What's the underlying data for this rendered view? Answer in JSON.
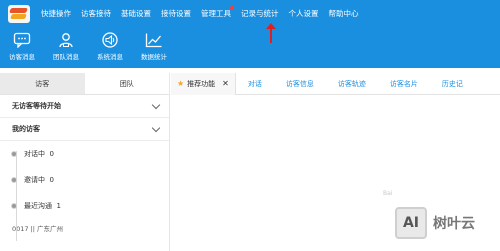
{
  "header": {
    "menu": [
      {
        "label": "快捷操作"
      },
      {
        "label": "访客接待"
      },
      {
        "label": "基础设置"
      },
      {
        "label": "接待设置"
      },
      {
        "label": "管理工具"
      },
      {
        "label": "记录与统计"
      },
      {
        "label": "个人设置"
      },
      {
        "label": "帮助中心"
      }
    ],
    "tools": [
      {
        "label": "访客消息",
        "icon": "chat-bubble-icon"
      },
      {
        "label": "团队消息",
        "icon": "team-icon"
      },
      {
        "label": "系统消息",
        "icon": "speaker-icon"
      },
      {
        "label": "数据统计",
        "icon": "trend-chart-icon"
      }
    ],
    "accent": "#1a8fe0"
  },
  "left_panel": {
    "tabs": [
      {
        "label": "访客"
      },
      {
        "label": "团队"
      }
    ],
    "sections": [
      {
        "label": "无访客等待开始"
      },
      {
        "label": "我的访客"
      }
    ],
    "rows": [
      {
        "label": "对话中",
        "count": "0"
      },
      {
        "label": "邀请中",
        "count": "0"
      },
      {
        "label": "最近沟通",
        "count": "1"
      }
    ],
    "visitor": "0017 || 广东广州"
  },
  "content_tabs": {
    "pinned": "推荐功能",
    "tabs": [
      {
        "label": "对话"
      },
      {
        "label": "访客信息"
      },
      {
        "label": "访客轨迹"
      },
      {
        "label": "访客名片"
      },
      {
        "label": "历史记"
      }
    ]
  },
  "watermark": {
    "logo": "AI",
    "text": "树叶云",
    "faint": "Bai"
  }
}
